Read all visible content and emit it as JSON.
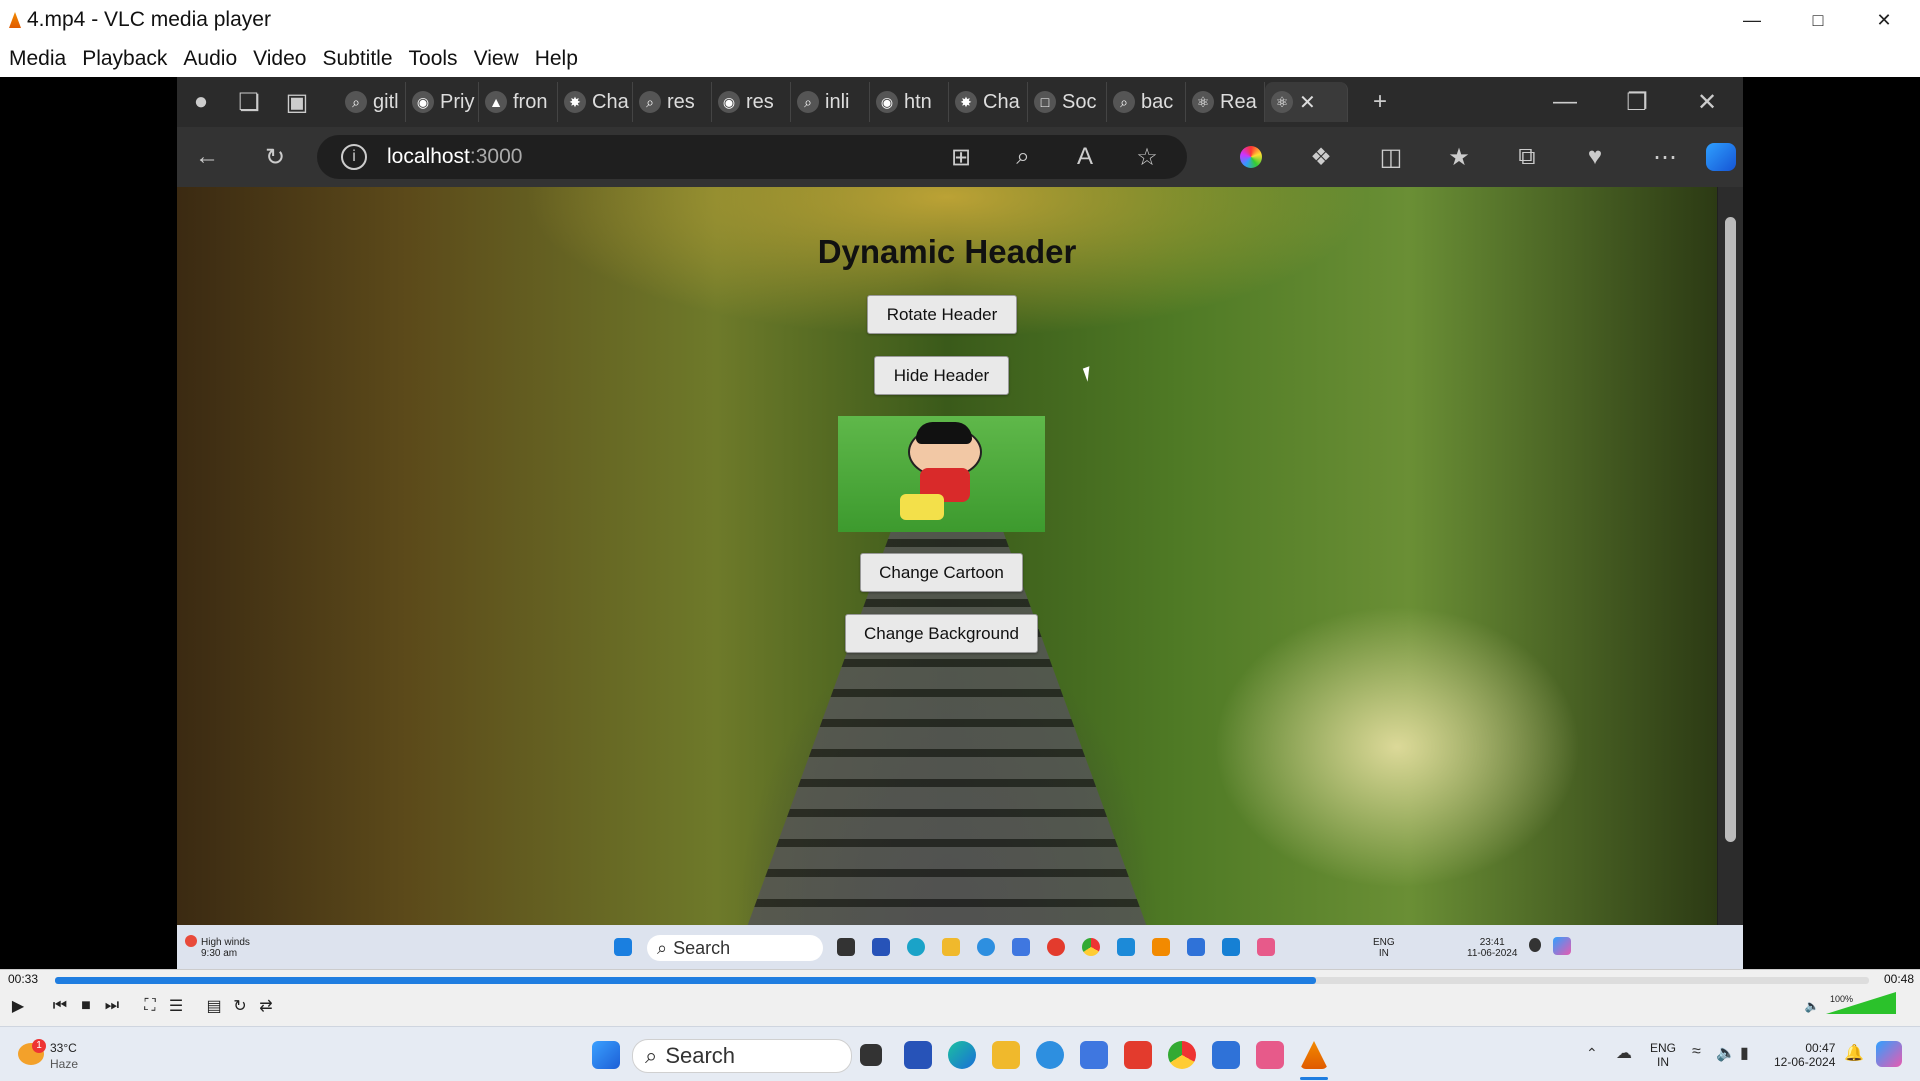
{
  "vlc": {
    "title": "4.mp4 - VLC media player",
    "menu": [
      "Media",
      "Playback",
      "Audio",
      "Video",
      "Subtitle",
      "Tools",
      "View",
      "Help"
    ],
    "time_elapsed": "00:33",
    "time_total": "00:48",
    "progress": 0.695,
    "volume_label": "100%",
    "volume": 1.0
  },
  "browser": {
    "tabs": [
      "gitl",
      "Priy",
      "fron",
      "Cha",
      "res",
      "res",
      "inli",
      "htn",
      "Cha",
      "Soc",
      "bac",
      "Rea"
    ],
    "url_host": "localhost",
    "url_port": ":3000"
  },
  "page": {
    "title": "Dynamic Header",
    "buttons": {
      "rotate": "Rotate Header",
      "hide": "Hide Header",
      "change_cartoon": "Change Cartoon",
      "change_background": "Change Background"
    }
  },
  "inner_taskbar": {
    "weather_line1": "High winds",
    "weather_line2": "9:30 am",
    "search": "Search",
    "lang1": "ENG",
    "lang2": "IN",
    "time": "23:41",
    "date": "11-06-2024"
  },
  "taskbar": {
    "weather_temp": "33°C",
    "weather_desc": "Haze",
    "weather_badge": "1",
    "search": "Search",
    "lang1": "ENG",
    "lang2": "IN",
    "time": "00:47",
    "date": "12-06-2024"
  },
  "colors": {
    "accent": "#1f7de0",
    "vlc_orange": "#f28a00"
  }
}
